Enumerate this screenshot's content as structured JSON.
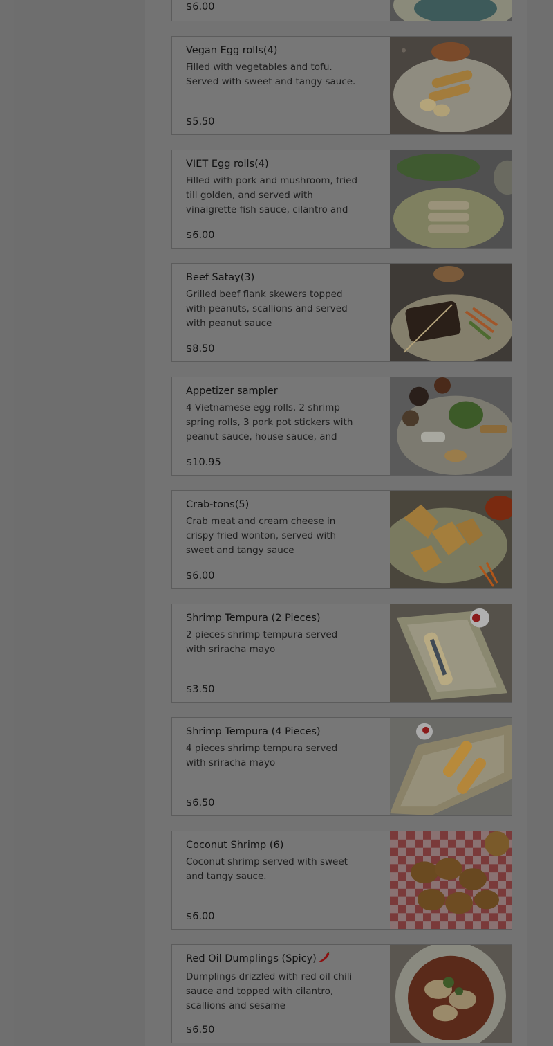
{
  "menu": {
    "top_partial_price": "$6.00",
    "items": [
      {
        "name": "Vegan Egg rolls(4)",
        "description": "Filled with vegetables and tofu. Served with sweet and tangy sauce.",
        "price": "$5.50",
        "image": "vegan egg rolls plate"
      },
      {
        "name": "VIET Egg rolls(4)",
        "description": "Filled with pork and mushroom, fried till golden, and served with vinaigrette fish sauce, cilantro and",
        "price": "$6.00",
        "image": "viet egg rolls plate"
      },
      {
        "name": "Beef Satay(3)",
        "description": "Grilled beef flank skewers topped with peanuts, scallions and served with peanut sauce",
        "price": "$8.50",
        "image": "beef satay plate"
      },
      {
        "name": "Appetizer sampler",
        "description": "4 Vietnamese egg rolls, 2 shrimp spring rolls, 3 pork pot stickers with peanut sauce, house sauce, and",
        "price": "$10.95",
        "image": "appetizer sampler plate"
      },
      {
        "name": "Crab-tons(5)",
        "description": "Crab meat and cream cheese in crispy fried wonton, served with sweet and tangy sauce",
        "price": "$6.00",
        "image": "crab-tons plate"
      },
      {
        "name": "Shrimp Tempura (2 Pieces)",
        "description": "2 pieces shrimp tempura served with sriracha mayo",
        "price": "$3.50",
        "image": "shrimp tempura 2 plate"
      },
      {
        "name": "Shrimp Tempura (4 Pieces)",
        "description": "4 pieces shrimp tempura served with sriracha mayo",
        "price": "$6.50",
        "image": "shrimp tempura 4 plate"
      },
      {
        "name": "Coconut Shrimp (6)",
        "description": "Coconut shrimp served with sweet and tangy sauce.",
        "price": "$6.00",
        "image": "coconut shrimp basket"
      },
      {
        "name": "Red Oil Dumplings (Spicy)",
        "description": "Dumplings drizzled with red oil chili sauce and topped with cilantro, scallions and sesame",
        "price": "$6.50",
        "image": "red oil dumplings bowl",
        "spicy_icon": "chili-pepper-icon"
      }
    ]
  },
  "colors": {
    "overlay_bg": "#6f6f6f",
    "card_bg": "#777777",
    "card_border": "#5c5c5c",
    "text": "#111111",
    "chili": "#8b1010"
  }
}
